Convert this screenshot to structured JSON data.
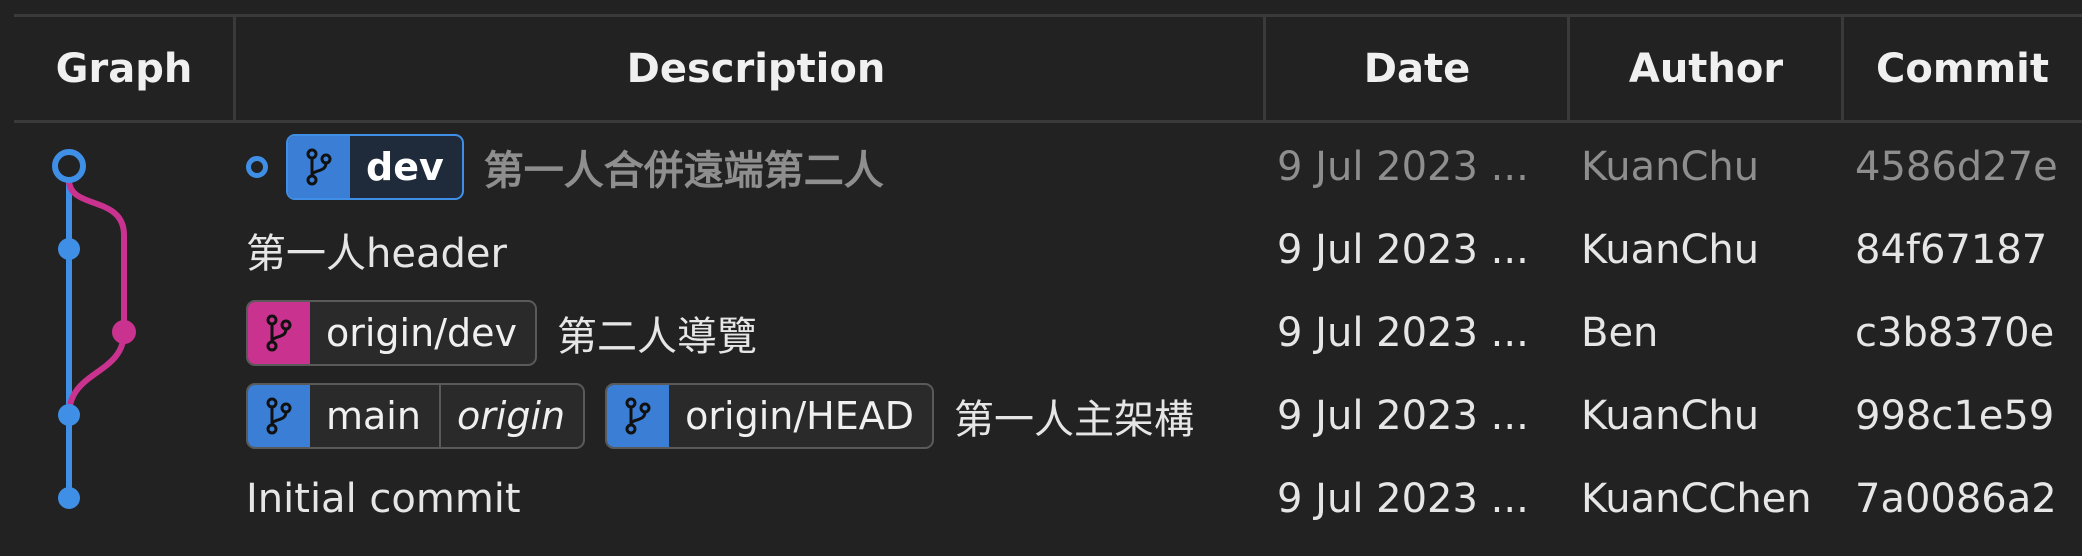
{
  "header": {
    "graph": "Graph",
    "description": "Description",
    "date": "Date",
    "author": "Author",
    "commit": "Commit"
  },
  "colors": {
    "main_lane": "#3f8fe6",
    "dev_lane": "#c9338f",
    "background": "#222222"
  },
  "rows": [
    {
      "refs": [
        {
          "label": "dev",
          "icon": "branch-icon",
          "color": "#3a7fd5",
          "current": true
        }
      ],
      "message": "第一人合併遠端第二人",
      "date": "9 Jul 2023 ...",
      "author": "KuanChu",
      "commit": "4586d27e",
      "uncommitted_marker": true
    },
    {
      "refs": [],
      "message": "第一人header",
      "date": "9 Jul 2023 ...",
      "author": "KuanChu",
      "commit": "84f67187"
    },
    {
      "refs": [
        {
          "label": "origin/dev",
          "icon": "branch-icon",
          "color": "#c9338f"
        }
      ],
      "message": "第二人導覽",
      "date": "9 Jul 2023 ...",
      "author": "Ben",
      "commit": "c3b8370e"
    },
    {
      "refs": [
        {
          "label": "main",
          "remote": "origin",
          "icon": "branch-icon",
          "color": "#3a7fd5"
        },
        {
          "label": "origin/HEAD",
          "icon": "branch-icon",
          "color": "#3a7fd5"
        }
      ],
      "message": "第一人主架構",
      "date": "9 Jul 2023 ...",
      "author": "KuanChu",
      "commit": "998c1e59"
    },
    {
      "refs": [],
      "message": "Initial commit",
      "date": "9 Jul 2023 ...",
      "author": "KuanCChen",
      "commit": "7a0086a2"
    }
  ]
}
